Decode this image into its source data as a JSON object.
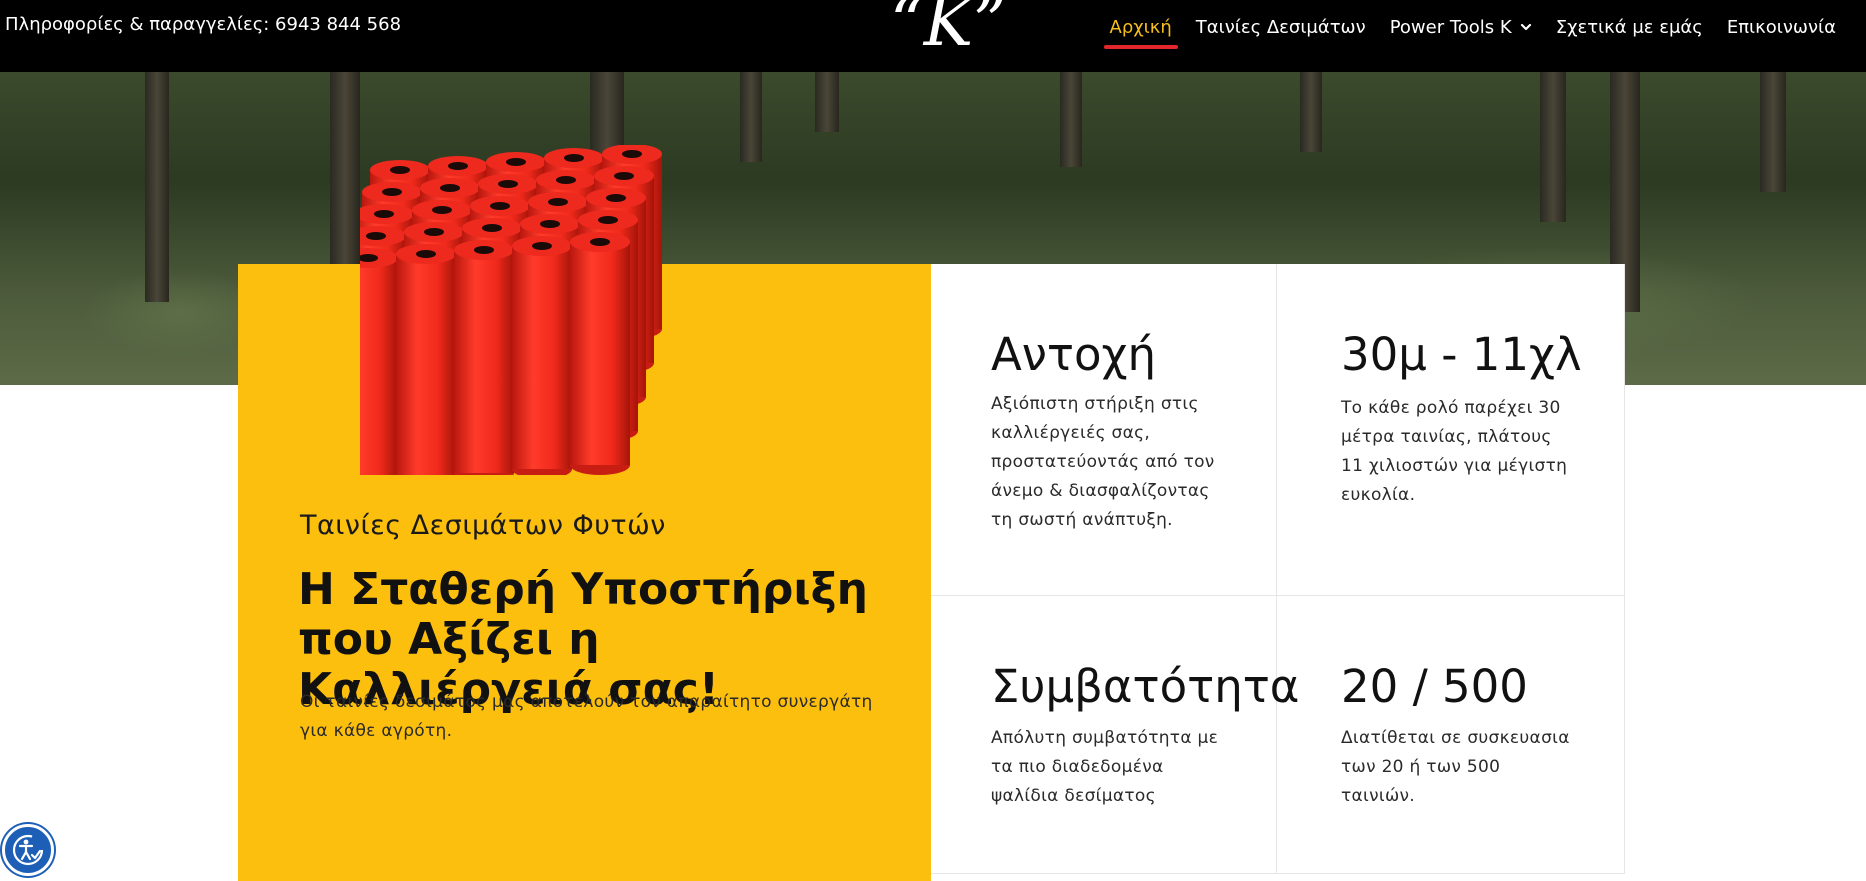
{
  "header": {
    "contact": "Πληροφορίες & παραγγελίες: 6943 844 568",
    "logo": "“K”",
    "nav": [
      {
        "label": "Αρχική",
        "active": true
      },
      {
        "label": "Ταινίες Δεσιμάτων"
      },
      {
        "label": "Power Tools K",
        "has_dropdown": true
      },
      {
        "label": "Σχετικά με εμάς"
      },
      {
        "label": "Επικοινωνία"
      }
    ]
  },
  "intro": {
    "subtitle": "Ταινίες Δεσιμάτων Φυτών",
    "headline": "Η Σταθερή Υποστήριξη που Αξίζει η Καλλιέργειά σας!",
    "text": "Οι ταινίες δεσιμάτος μας αποτελούν τον απαραίτητο συνεργάτη για κάθε αγρότη."
  },
  "features": [
    {
      "title": "Αντοχή",
      "text": "Αξιόπιστη στήριξη στις καλλιέργειές σας, προστατεύοντάς από τον άνεμο & διασφαλίζοντας τη σωστή ανάπτυξη."
    },
    {
      "title": "30μ - 11χλ",
      "text": "Το κάθε ρολό παρέχει 30 μέτρα ταινίας, πλάτους 11 χιλιοστών για μέγιστη ευκολία."
    },
    {
      "title": "Συμβατότητα",
      "text": "Απόλυτη συμβατότητα με τα πιο διαδεδομένα ψαλίδια δεσίματος"
    },
    {
      "title": "20 / 500",
      "text": "Διατίθεται σε συσκευασια των 20 ή των 500 ταινιών."
    }
  ],
  "colors": {
    "accent_yellow": "#fdbf0e",
    "nav_active": "#f6be1d",
    "nav_underline": "#e1262c",
    "roll_red": "#ee2a1f"
  },
  "icons": {
    "nav_dropdown": "chevron-down-icon",
    "accessibility": "accessibility-icon"
  }
}
